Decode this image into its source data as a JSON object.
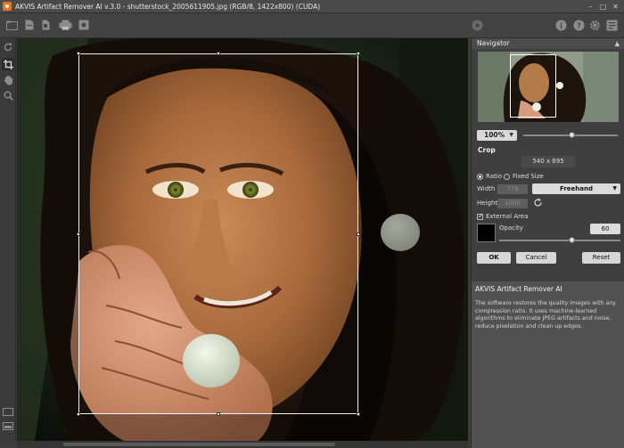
{
  "window": {
    "title": "AKVIS Artifact Remover AI v.3.0 - shutterstock_2005611905.jpg (RGB/8, 1422x800) (CUDA)"
  },
  "toolbar": {
    "icons": [
      "open-icon",
      "save-icon",
      "batch-icon",
      "print-icon",
      "share-icon",
      "run-icon",
      "info-icon",
      "help-icon",
      "settings-icon",
      "news-icon"
    ]
  },
  "left_tools": [
    "crop-icon",
    "hand-icon",
    "zoom-icon"
  ],
  "navigator": {
    "header": "Navigator",
    "zoom_value": "100%",
    "zoom_level_fraction": 0.52
  },
  "crop": {
    "title": "Crop",
    "size": "540 x 695",
    "ratio_label": "Ratio",
    "fixed_size_label": "Fixed Size",
    "mode": "ratio",
    "width_label": "Width",
    "width_value": "778",
    "height_label": "Height",
    "height_value": "1000",
    "ratio_preset": "Freehand",
    "external_area_label": "External Area",
    "external_area_checked": true,
    "opacity_label": "Opacity",
    "opacity_value": "60",
    "ok_label": "OK",
    "cancel_label": "Cancel",
    "reset_label": "Reset"
  },
  "info": {
    "title": "AKVIS Artifact Remover AI",
    "body": "The software restores the quality images with any compression ratio. It uses machine-learned algorithms to eliminate JPEG artifacts and noise, reduce pixelation and clean up edges."
  },
  "colors": {
    "accent": "#e3742a",
    "panel": "#3f3f3f",
    "crop_border": "#f2f2f2"
  }
}
